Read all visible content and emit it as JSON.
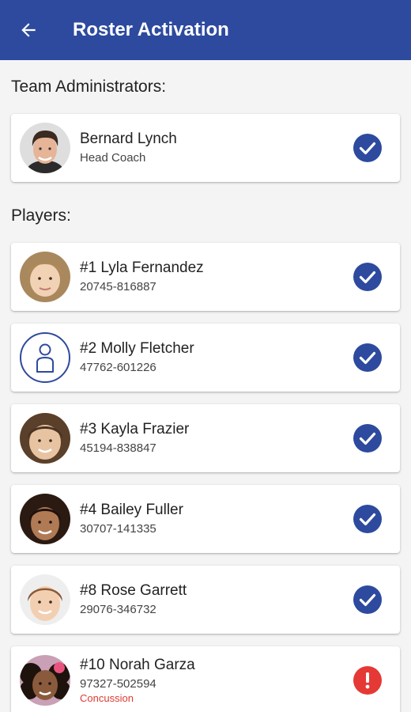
{
  "header": {
    "title": "Roster Activation",
    "back_icon": "arrow-left-icon"
  },
  "colors": {
    "primary": "#2d4a9e",
    "alert": "#e53935",
    "injury_text": "#e03a30"
  },
  "sections": {
    "admins_title": "Team Administrators:",
    "players_title": "Players:"
  },
  "admins": [
    {
      "name": "Bernard Lynch",
      "role": "Head Coach",
      "status": "check-circle-icon"
    }
  ],
  "players": [
    {
      "name": "#1 Lyla Fernandez",
      "id": "20745-816887",
      "status": "check-circle-icon"
    },
    {
      "name": "#2 Molly Fletcher",
      "id": "47762-601226",
      "status": "check-circle-icon",
      "avatar": "person-icon"
    },
    {
      "name": "#3 Kayla Frazier",
      "id": "45194-838847",
      "status": "check-circle-icon"
    },
    {
      "name": "#4 Bailey Fuller",
      "id": "30707-141335",
      "status": "check-circle-icon"
    },
    {
      "name": "#8 Rose Garrett",
      "id": "29076-346732",
      "status": "check-circle-icon"
    },
    {
      "name": "#10 Norah Garza",
      "id": "97327-502594",
      "injury": "Concussion",
      "status": "alert-circle-icon"
    }
  ]
}
